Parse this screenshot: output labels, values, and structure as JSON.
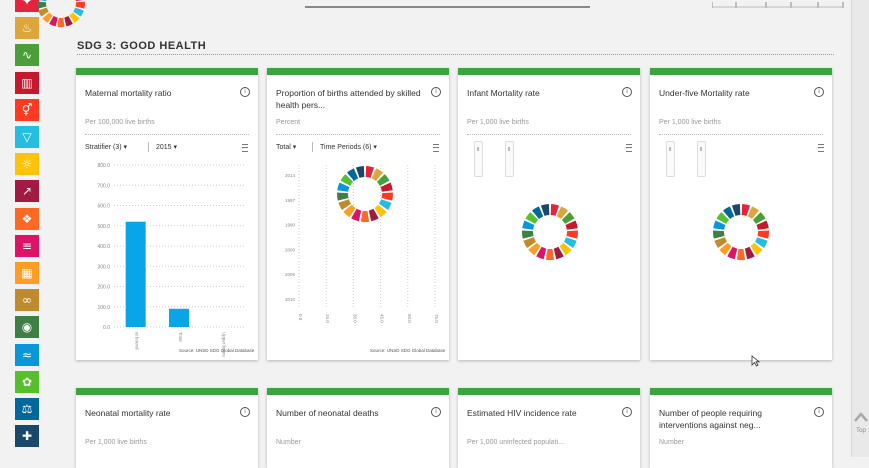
{
  "section": {
    "title": "SDG 3: GOOD HEALTH"
  },
  "sdg_strip": {
    "colors": [
      "#e5243b",
      "#dda63a",
      "#4c9f38",
      "#c5192d",
      "#ff3a21",
      "#26bde2",
      "#fcc30b",
      "#a21942",
      "#fd6925",
      "#dd1367",
      "#fd9d24",
      "#bf8b2e",
      "#3f7e44",
      "#0a97d9",
      "#56c02b",
      "#00689d",
      "#19486a"
    ]
  },
  "sdg_wheel_colors": [
    "#e5243b",
    "#dda63a",
    "#4c9f38",
    "#c5192d",
    "#ff3a21",
    "#26bde2",
    "#fcc30b",
    "#a21942",
    "#fd6925",
    "#dd1367",
    "#fd9d24",
    "#bf8b2e",
    "#3f7e44",
    "#0a97d9",
    "#56c02b",
    "#00689d",
    "#19486a"
  ],
  "cards": [
    {
      "title": "Maternal mortality ratio",
      "unit": "Per 100,000 live births",
      "filter1": "Stratifier (3) ▾",
      "filter2": "2015 ▾",
      "source": "Source: UNSD SDG Global Database"
    },
    {
      "title": "Proportion of births attended by skilled health pers...",
      "unit": "Percent",
      "filter1": "Total ▾",
      "filter2": "Time Periods (6) ▾",
      "source": "Source: UNSD SDG Global Database"
    },
    {
      "title": "Infant Mortality rate",
      "unit": "Per 1,000 live births"
    },
    {
      "title": "Under-five Mortality rate",
      "unit": "Per 1,000 live births"
    },
    {
      "title": "Neonatal mortality rate",
      "unit": "Per 1,000 live births"
    },
    {
      "title": "Number of neonatal deaths",
      "unit": "Number"
    },
    {
      "title": "Estimated HIV incidence rate",
      "unit": "Per 1,000 uninfected populati..."
    },
    {
      "title": "Number of people requiring interventions against neg...",
      "unit": "Number"
    }
  ],
  "chart_data": [
    {
      "type": "bar",
      "categories": [
        "at bound",
        "Total",
        "Upper bound"
      ],
      "values": [
        520,
        90,
        0
      ],
      "ylim": [
        0,
        800
      ],
      "yticks": [
        "0.0",
        "100.0",
        "200.0",
        "300.0",
        "400.0",
        "500.0",
        "600.0",
        "700.0",
        "800.0"
      ],
      "color": "#0aa5e8"
    },
    {
      "type": "line",
      "yticks": [
        "2014",
        "1997",
        "1990",
        "2000",
        "2005",
        "2010"
      ],
      "xticks": [
        "0.0",
        "15.0",
        "30.0",
        "45.0",
        "60.0",
        "75.0"
      ]
    }
  ],
  "scroll_top": {
    "label": "Top"
  }
}
